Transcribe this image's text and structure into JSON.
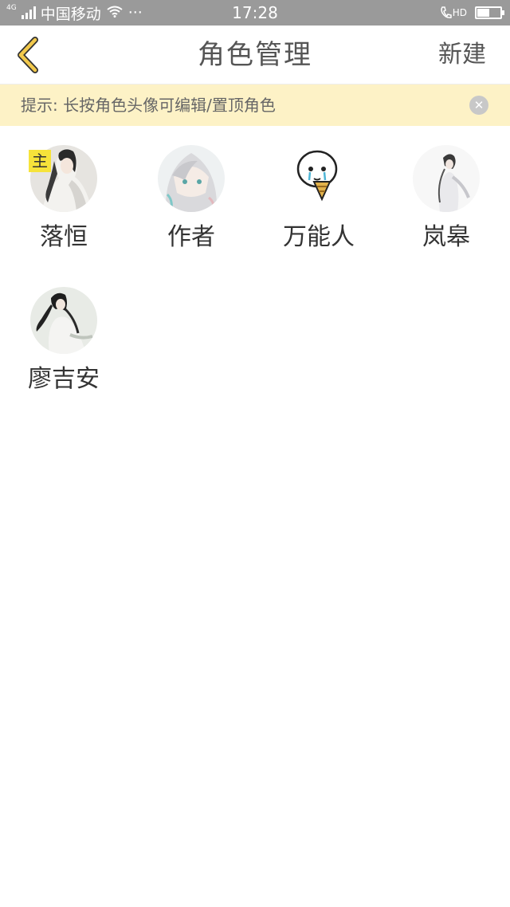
{
  "status_bar": {
    "network": "4G",
    "carrier": "中国移动",
    "more": "···",
    "time": "17:28",
    "call_hd": "HD",
    "battery_level": 0.55,
    "icons": [
      "signal-icon",
      "wifi-icon",
      "call-hd-icon",
      "battery-icon"
    ]
  },
  "nav": {
    "back_icon": "chevron-left-icon",
    "title": "角色管理",
    "action": "新建",
    "accent": "#f2c94c"
  },
  "tip": {
    "text": "提示: 长按角色头像可编辑/置顶角色",
    "close_icon": "close-icon",
    "close_glyph": "✕",
    "background": "#fdf2c6"
  },
  "roles": [
    {
      "name": "落恒",
      "badge": "主",
      "avatar": "avatar-ink-man"
    },
    {
      "name": "作者",
      "avatar": "avatar-silver-hair-girl"
    },
    {
      "name": "万能人",
      "avatar": "avatar-crying-cartoon"
    },
    {
      "name": "岚皋",
      "avatar": "avatar-ink-figure"
    },
    {
      "name": "廖吉安",
      "avatar": "avatar-black-hair-man"
    }
  ],
  "colors": {
    "badge": "#f6e33a",
    "text": "#333333",
    "statusbar": "#9a9a9a"
  }
}
